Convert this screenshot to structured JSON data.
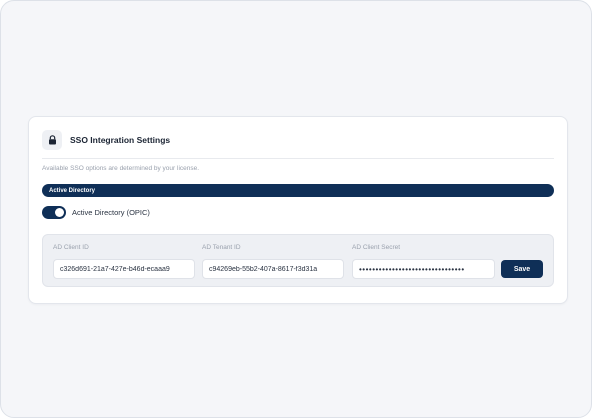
{
  "card": {
    "title": "SSO Integration Settings",
    "icon": "lock-icon",
    "hint": "Available SSO options are determined by your license."
  },
  "section": {
    "label": "Active Directory"
  },
  "toggle": {
    "label": "Active Directory (OPIC)",
    "checked": true
  },
  "fields": {
    "client_id": {
      "label": "AD Client ID",
      "value": "c326d691-21a7-427e-b46d-ecaaa9"
    },
    "tenant_id": {
      "label": "AD Tenant ID",
      "value": "c94269eb-55b2-407a-8617-f3d31a"
    },
    "client_secret": {
      "label": "AD Client Secret",
      "value": "••••••••••••••••••••••••••••••••"
    }
  },
  "actions": {
    "save_label": "Save"
  },
  "colors": {
    "primary": "#0f2f57",
    "background": "#f5f6f9",
    "panel": "#eef0f4"
  }
}
